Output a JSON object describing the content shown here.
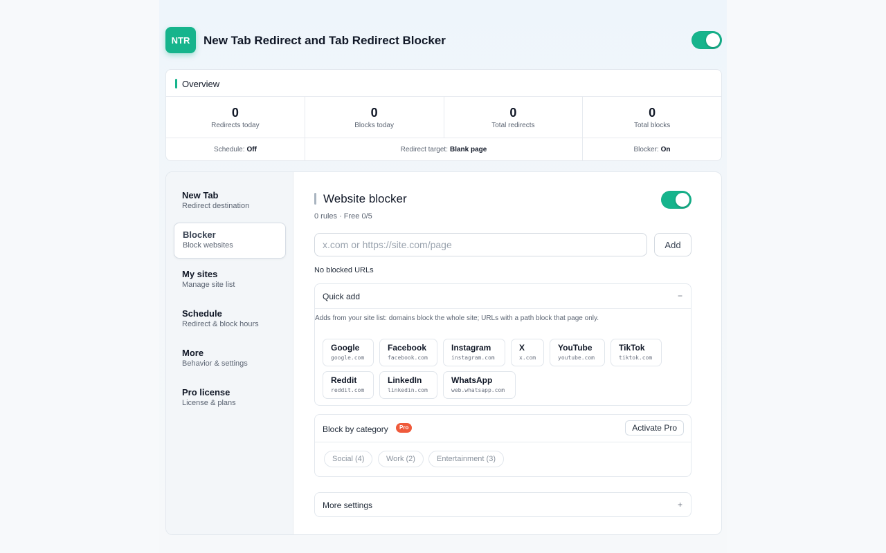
{
  "app": {
    "logo_text": "NTR",
    "title": "New Tab Redirect and Tab Redirect Blocker",
    "enabled": true
  },
  "overview": {
    "title": "Overview",
    "stats": [
      {
        "value": "0",
        "label": "Redirects today"
      },
      {
        "value": "0",
        "label": "Blocks today"
      },
      {
        "value": "0",
        "label": "Total redirects"
      },
      {
        "value": "0",
        "label": "Total blocks"
      }
    ],
    "schedule_label": "Schedule:",
    "schedule_value": "Off",
    "target_label": "Redirect target:",
    "target_value": "Blank page",
    "blocker_label": "Blocker:",
    "blocker_value": "On"
  },
  "sidebar": {
    "items": [
      {
        "title": "New Tab",
        "subtitle": "Redirect destination"
      },
      {
        "title": "Blocker",
        "subtitle": "Block websites"
      },
      {
        "title": "My sites",
        "subtitle": "Manage site list"
      },
      {
        "title": "Schedule",
        "subtitle": "Redirect & block hours"
      },
      {
        "title": "More",
        "subtitle": "Behavior & settings"
      },
      {
        "title": "Pro license",
        "subtitle": "License & plans"
      }
    ],
    "active_index": 1
  },
  "blocker": {
    "title": "Website blocker",
    "enabled": true,
    "subtitle": "0 rules · Free 0/5",
    "input_placeholder": "x.com or https://site.com/page",
    "input_value": "",
    "add_label": "Add",
    "empty_text": "No blocked URLs",
    "quick_add": {
      "title": "Quick add",
      "toggle_symbol": "−",
      "description": "Adds from your site list: domains block the whole site; URLs with a path block that page only.",
      "sites": [
        {
          "name": "Google",
          "domain": "google.com"
        },
        {
          "name": "Facebook",
          "domain": "facebook.com"
        },
        {
          "name": "Instagram",
          "domain": "instagram.com"
        },
        {
          "name": "X",
          "domain": "x.com"
        },
        {
          "name": "YouTube",
          "domain": "youtube.com"
        },
        {
          "name": "TikTok",
          "domain": "tiktok.com"
        },
        {
          "name": "Reddit",
          "domain": "reddit.com"
        },
        {
          "name": "LinkedIn",
          "domain": "linkedin.com"
        },
        {
          "name": "WhatsApp",
          "domain": "web.whatsapp.com"
        }
      ]
    },
    "category": {
      "title": "Block by category",
      "badge": "Pro",
      "activate_label": "Activate Pro",
      "chips": [
        "Social (4)",
        "Work (2)",
        "Entertainment (3)"
      ]
    },
    "more_settings": {
      "title": "More settings",
      "toggle_symbol": "+"
    }
  },
  "colors": {
    "accent": "#16b48c",
    "pro_badge": "#ef5a3b"
  }
}
